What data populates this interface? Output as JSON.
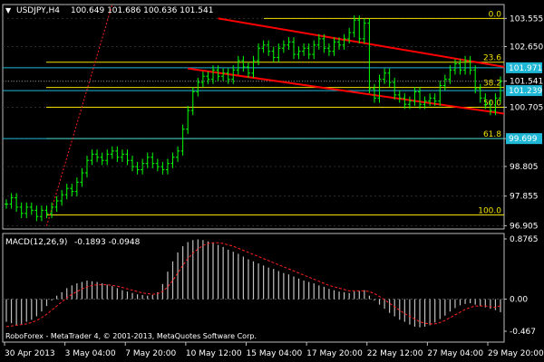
{
  "chart_data": [
    {
      "type": "line",
      "title": "USDJPY,H4",
      "ohlc_header": "100.649 101.686 100.636 101.541",
      "ylim": [
        96.8,
        104.0
      ],
      "y_ticks": [
        "103.555",
        "102.650",
        "101.541",
        "100.705",
        "99.699",
        "98.805",
        "97.855",
        "96.905"
      ],
      "x_ticks": [
        "30 Apr 2013",
        "3 May 04:00",
        "7 May 20:00",
        "10 May 12:00",
        "15 May 04:00",
        "17 May 20:00",
        "22 May 12:00",
        "27 May 04:00",
        "29 May 20:00"
      ],
      "fib_levels": [
        {
          "label": "0.0",
          "value": 103.555
        },
        {
          "label": "23.6",
          "value": 102.15
        },
        {
          "label": "38.2",
          "value": 101.341
        },
        {
          "label": "50.0",
          "value": 100.705
        },
        {
          "label": "61.8",
          "value": 99.699
        },
        {
          "label": "100.0",
          "value": 97.25
        }
      ],
      "horizontal_prices": [
        {
          "label": "101.971",
          "value": 101.971
        },
        {
          "label": "101.239",
          "value": 101.239
        },
        {
          "label": "99.699",
          "value": 99.699
        }
      ],
      "series": [
        {
          "name": "USDJPY",
          "values": [
            97.6,
            97.8,
            97.5,
            97.3,
            97.5,
            97.4,
            97.2,
            97.4,
            97.3,
            97.5,
            97.7,
            97.9,
            98.1,
            98.0,
            98.3,
            98.6,
            99.0,
            99.2,
            99.1,
            99.0,
            99.2,
            99.3,
            99.1,
            99.2,
            99.0,
            98.8,
            98.7,
            98.9,
            99.1,
            98.9,
            98.8,
            98.7,
            98.9,
            99.1,
            99.3,
            100.0,
            100.6,
            101.2,
            101.5,
            101.7,
            101.6,
            101.9,
            101.7,
            101.8,
            101.6,
            101.9,
            102.2,
            102.0,
            101.8,
            102.2,
            102.6,
            102.7,
            102.5,
            102.3,
            102.6,
            102.7,
            102.8,
            102.4,
            102.5,
            102.6,
            102.4,
            102.7,
            102.9,
            102.6,
            102.5,
            102.8,
            102.7,
            102.9,
            103.1,
            103.5,
            102.9,
            103.4,
            101.3,
            101.0,
            101.6,
            101.8,
            101.5,
            101.1,
            101.0,
            100.8,
            100.9,
            101.2,
            100.8,
            100.9,
            101.0,
            100.9,
            101.4,
            101.6,
            101.9,
            102.1,
            101.9,
            102.2,
            101.9,
            101.3,
            101.0,
            100.8,
            100.6,
            101.0,
            101.541
          ]
        }
      ],
      "channel_upper": {
        "x": [
          42,
          72
        ],
        "y": [
          103.555,
          102.0
        ]
      },
      "channel_lower": {
        "x": [
          36,
          98
        ],
        "y": [
          101.95,
          100.5
        ]
      },
      "colors": {
        "background": "#000000",
        "price": "#00ff00",
        "fib": "#f2e100",
        "channel": "#ff0000",
        "levels": "#1fb7d6",
        "grid": "#3a3a3a"
      }
    },
    {
      "type": "bar",
      "title": "MACD(12,26,9)",
      "values_header": "-0.1893 -0.0948",
      "ylim": [
        -0.467,
        0.8765
      ],
      "y_ticks": [
        "0.8765",
        "0.00",
        "-0.467"
      ],
      "series": [
        {
          "name": "MACD",
          "values": [
            -0.33,
            -0.35,
            -0.38,
            -0.36,
            -0.33,
            -0.3,
            -0.25,
            -0.18,
            -0.1,
            -0.02,
            0.05,
            0.1,
            0.16,
            0.2,
            0.23,
            0.25,
            0.27,
            0.26,
            0.25,
            0.23,
            0.21,
            0.19,
            0.16,
            0.13,
            0.11,
            0.09,
            0.07,
            0.06,
            0.05,
            0.06,
            0.1,
            0.22,
            0.4,
            0.55,
            0.68,
            0.77,
            0.83,
            0.86,
            0.87,
            0.86,
            0.84,
            0.82,
            0.79,
            0.76,
            0.72,
            0.69,
            0.66,
            0.62,
            0.58,
            0.55,
            0.52,
            0.49,
            0.46,
            0.44,
            0.41,
            0.38,
            0.36,
            0.33,
            0.3,
            0.27,
            0.25,
            0.23,
            0.2,
            0.18,
            0.15,
            0.13,
            0.11,
            0.1,
            0.09,
            0.11,
            0.12,
            0.13,
            0.05,
            -0.02,
            -0.08,
            -0.14,
            -0.2,
            -0.25,
            -0.3,
            -0.33,
            -0.37,
            -0.4,
            -0.41,
            -0.4,
            -0.38,
            -0.34,
            -0.29,
            -0.24,
            -0.18,
            -0.13,
            -0.09,
            -0.07,
            -0.06,
            -0.08,
            -0.1,
            -0.12,
            -0.14,
            -0.16,
            -0.1893
          ]
        },
        {
          "name": "Signal",
          "values": [
            -0.4,
            -0.39,
            -0.38,
            -0.37,
            -0.36,
            -0.34,
            -0.31,
            -0.27,
            -0.22,
            -0.16,
            -0.1,
            -0.04,
            0.02,
            0.07,
            0.11,
            0.15,
            0.18,
            0.2,
            0.21,
            0.21,
            0.21,
            0.2,
            0.19,
            0.17,
            0.15,
            0.13,
            0.11,
            0.09,
            0.08,
            0.07,
            0.08,
            0.11,
            0.18,
            0.27,
            0.38,
            0.49,
            0.59,
            0.67,
            0.73,
            0.78,
            0.81,
            0.82,
            0.82,
            0.81,
            0.79,
            0.77,
            0.74,
            0.71,
            0.68,
            0.65,
            0.62,
            0.59,
            0.56,
            0.53,
            0.5,
            0.47,
            0.44,
            0.41,
            0.38,
            0.35,
            0.32,
            0.29,
            0.26,
            0.23,
            0.2,
            0.18,
            0.16,
            0.14,
            0.12,
            0.12,
            0.12,
            0.12,
            0.11,
            0.08,
            0.04,
            -0.01,
            -0.06,
            -0.11,
            -0.16,
            -0.21,
            -0.25,
            -0.29,
            -0.33,
            -0.35,
            -0.36,
            -0.36,
            -0.34,
            -0.31,
            -0.27,
            -0.23,
            -0.19,
            -0.15,
            -0.12,
            -0.1,
            -0.1,
            -0.1,
            -0.11,
            -0.12,
            -0.0948
          ]
        }
      ],
      "colors": {
        "histogram": "#c0c0c0",
        "signal": "#ff2020"
      }
    }
  ],
  "footer": {
    "copyright": "RoboForex - MetaTrader 4, © 2001-2013, MetaQuotes Software Corp."
  }
}
